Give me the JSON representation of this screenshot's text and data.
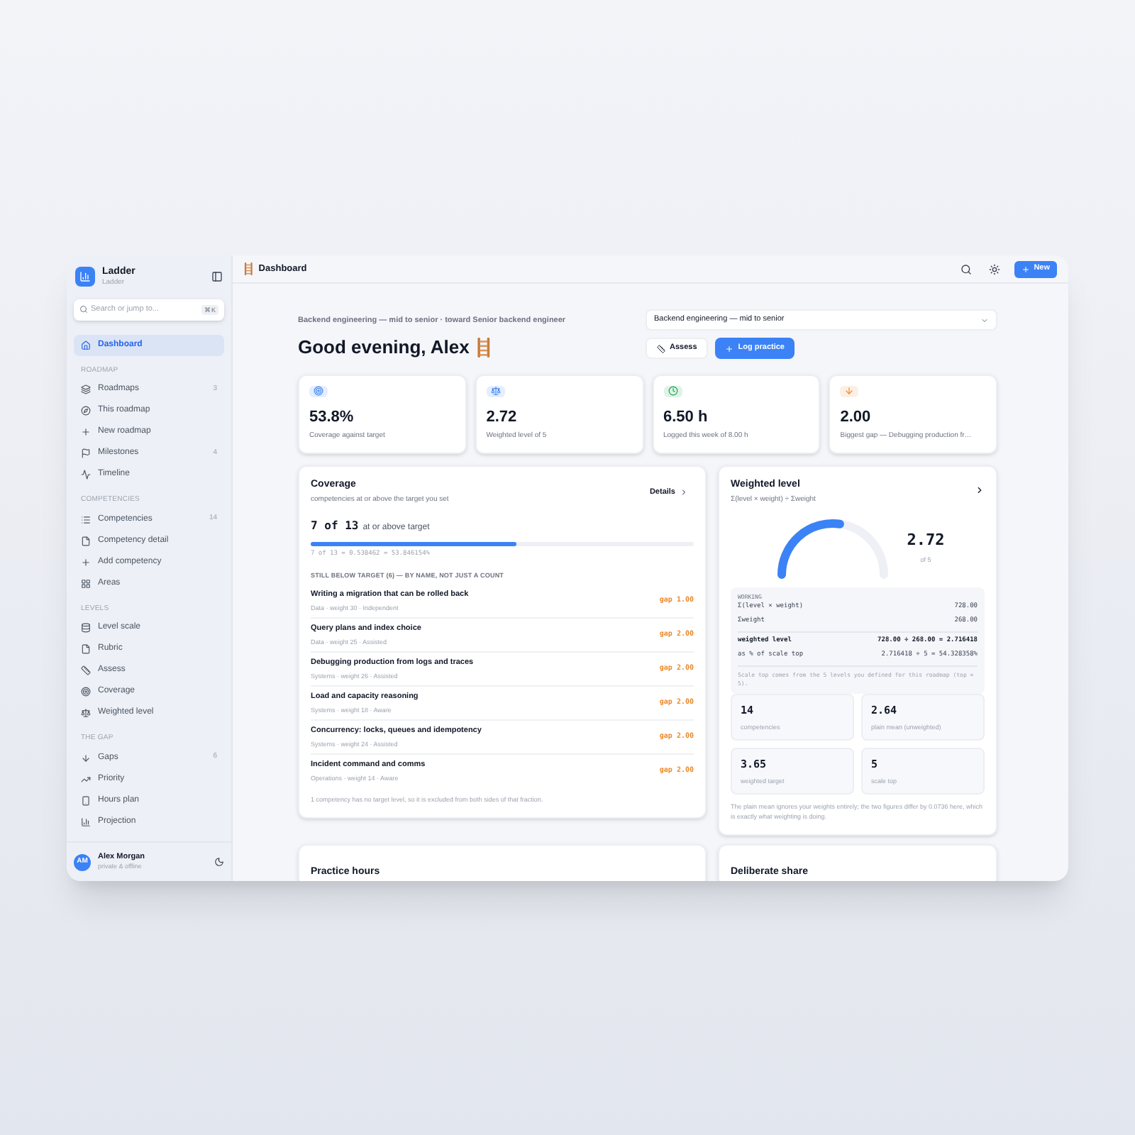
{
  "sidebar": {
    "app_name": "Ladder",
    "app_subtitle": "Ladder",
    "search": {
      "placeholder": "Search or jump to...",
      "shortcut": "⌘K"
    },
    "top_items": [
      {
        "label": "Dashboard",
        "selected": true
      }
    ],
    "sections": [
      {
        "title": "ROADMAP",
        "items": [
          {
            "label": "Roadmaps",
            "count": "3",
            "selected": false
          },
          {
            "label": "This roadmap",
            "selected": false
          },
          {
            "label": "New roadmap",
            "selected": false
          },
          {
            "label": "Milestones",
            "count": "4",
            "selected": false
          },
          {
            "label": "Timeline",
            "selected": false
          }
        ]
      },
      {
        "title": "COMPETENCIES",
        "items": [
          {
            "label": "Competencies",
            "count": "14",
            "selected": false
          },
          {
            "label": "Competency detail",
            "selected": false
          },
          {
            "label": "Add competency",
            "selected": false
          },
          {
            "label": "Areas",
            "selected": false
          }
        ]
      },
      {
        "title": "LEVELS",
        "items": [
          {
            "label": "Level scale",
            "selected": false
          },
          {
            "label": "Rubric",
            "selected": false
          },
          {
            "label": "Assess",
            "selected": false
          },
          {
            "label": "Coverage",
            "selected": false
          },
          {
            "label": "Weighted level",
            "selected": false
          }
        ]
      },
      {
        "title": "THE GAP",
        "items": [
          {
            "label": "Gaps",
            "count": "6",
            "selected": false
          },
          {
            "label": "Priority",
            "selected": false
          },
          {
            "label": "Hours plan",
            "selected": false
          },
          {
            "label": "Projection",
            "selected": false
          }
        ]
      }
    ],
    "user": {
      "initials": "AM",
      "name": "Alex Morgan",
      "status": "private & offline"
    }
  },
  "header": {
    "title": "Dashboard",
    "new_button": "New"
  },
  "context": "Backend engineering — mid to senior · toward Senior backend engineer",
  "greeting": "Good evening, Alex",
  "roadmap_select": {
    "value": "Backend engineering — mid to senior"
  },
  "actions": [
    "Assess",
    "Log practice"
  ],
  "stats": [
    {
      "value": "53.8%",
      "label": "Coverage against target",
      "color": "#3b82f6"
    },
    {
      "value": "2.72",
      "label": "Weighted level of 5",
      "color": "#3b82f6"
    },
    {
      "value": "6.50 h",
      "label": "Logged this week of 8.00 h",
      "color": "#16a34a"
    },
    {
      "value": "2.00",
      "label": "Biggest gap — Debugging production fr…",
      "color": "#ea8a2b"
    }
  ],
  "coverage": {
    "title": "Coverage",
    "subtitle": "competencies at or above the target you set",
    "details": "Details",
    "fraction": "7 of 13",
    "fraction_label": "at or above target",
    "level": 0.538,
    "formula": "7 of 13 = 0.538462 = 53.846154%",
    "list_title": "STILL BELOW TARGET (6) — BY NAME, NOT JUST A COUNT",
    "gaps": [
      {
        "name": "Writing a migration that can be rolled back",
        "meta": "Data · weight 30 · Independent",
        "gap": "gap 1.00"
      },
      {
        "name": "Query plans and index choice",
        "meta": "Data · weight 25 · Assisted",
        "gap": "gap 2.00"
      },
      {
        "name": "Debugging production from logs and traces",
        "meta": "Systems · weight 26 · Assisted",
        "gap": "gap 2.00"
      },
      {
        "name": "Load and capacity reasoning",
        "meta": "Systems · weight 18 · Aware",
        "gap": "gap 2.00"
      },
      {
        "name": "Concurrency: locks, queues and idempotency",
        "meta": "Systems · weight 24 · Assisted",
        "gap": "gap 2.00"
      },
      {
        "name": "Incident command and comms",
        "meta": "Operations · weight 14 · Aware",
        "gap": "gap 2.00"
      }
    ],
    "footnote": "1 competency has no target level, so it is excluded from both sides of that fraction."
  },
  "weighted": {
    "title": "Weighted level",
    "formula": "Σ(level × weight) ÷ Σweight",
    "value": "2.72",
    "of": "of 5",
    "working_title": "WORKING",
    "working": [
      {
        "label": "Σ(level × weight)",
        "value": "728.00",
        "kind": "plain"
      },
      {
        "label": "Σweight",
        "value": "268.00",
        "kind": "plain"
      },
      {
        "label": "weighted level",
        "value": "728.00 ÷ 268.00 = 2.716418",
        "kind": "total"
      },
      {
        "label": "as % of scale top",
        "value": "2.716418 ÷ 5 = 54.328358%",
        "kind": "plain"
      }
    ],
    "note": "Scale top comes from the 5 levels you defined for this roadmap (top = 5).",
    "tiles": [
      {
        "value": "14",
        "label": "competencies"
      },
      {
        "value": "2.64",
        "label": "plain mean (unweighted)"
      },
      {
        "value": "3.65",
        "label": "weighted target"
      },
      {
        "value": "5",
        "label": "scale top"
      }
    ],
    "footnote": "The plain mean ignores your weights entirely; the two figures differ by 0.0736 here, which is exactly what weighting is doing."
  },
  "bottom_cards": [
    "Practice hours",
    "Deliberate share"
  ]
}
